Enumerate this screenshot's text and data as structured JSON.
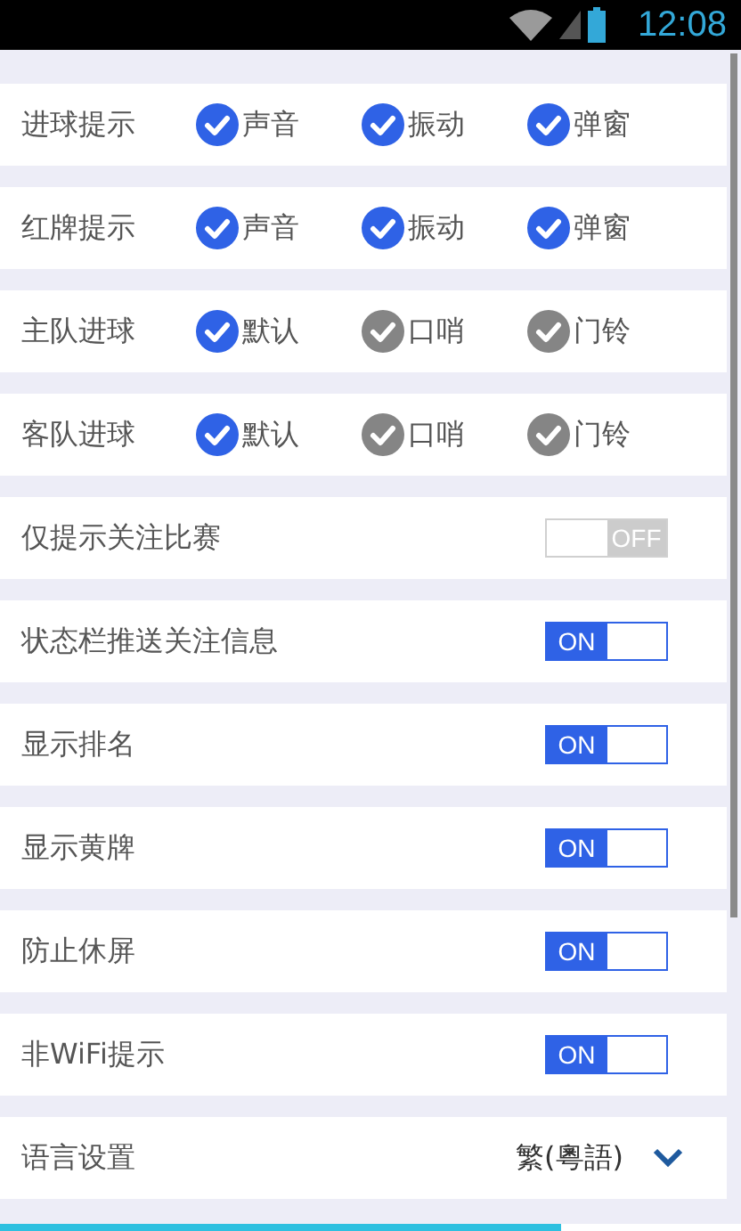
{
  "status_bar": {
    "time": "12:08"
  },
  "settings": [
    {
      "kind": "checks",
      "label": "进球提示",
      "options": [
        {
          "label": "声音",
          "checked": true
        },
        {
          "label": "振动",
          "checked": true
        },
        {
          "label": "弹窗",
          "checked": true
        }
      ]
    },
    {
      "kind": "checks",
      "label": "红牌提示",
      "options": [
        {
          "label": "声音",
          "checked": true
        },
        {
          "label": "振动",
          "checked": true
        },
        {
          "label": "弹窗",
          "checked": true
        }
      ]
    },
    {
      "kind": "checks",
      "label": "主队进球",
      "options": [
        {
          "label": "默认",
          "checked": true
        },
        {
          "label": "口哨",
          "checked": false
        },
        {
          "label": "门铃",
          "checked": false
        }
      ]
    },
    {
      "kind": "checks",
      "label": "客队进球",
      "options": [
        {
          "label": "默认",
          "checked": true
        },
        {
          "label": "口哨",
          "checked": false
        },
        {
          "label": "门铃",
          "checked": false
        }
      ]
    },
    {
      "kind": "toggle",
      "label": "仅提示关注比赛",
      "on": false,
      "state_text": "OFF"
    },
    {
      "kind": "toggle",
      "label": "状态栏推送关注信息",
      "on": true,
      "state_text": "ON"
    },
    {
      "kind": "toggle",
      "label": "显示排名",
      "on": true,
      "state_text": "ON"
    },
    {
      "kind": "toggle",
      "label": "显示黄牌",
      "on": true,
      "state_text": "ON"
    },
    {
      "kind": "toggle",
      "label": "防止休屏",
      "on": true,
      "state_text": "ON"
    },
    {
      "kind": "toggle",
      "label": "非WiFi提示",
      "on": true,
      "state_text": "ON"
    },
    {
      "kind": "select",
      "label": "语言设置",
      "value": "繁(粵語)"
    }
  ]
}
